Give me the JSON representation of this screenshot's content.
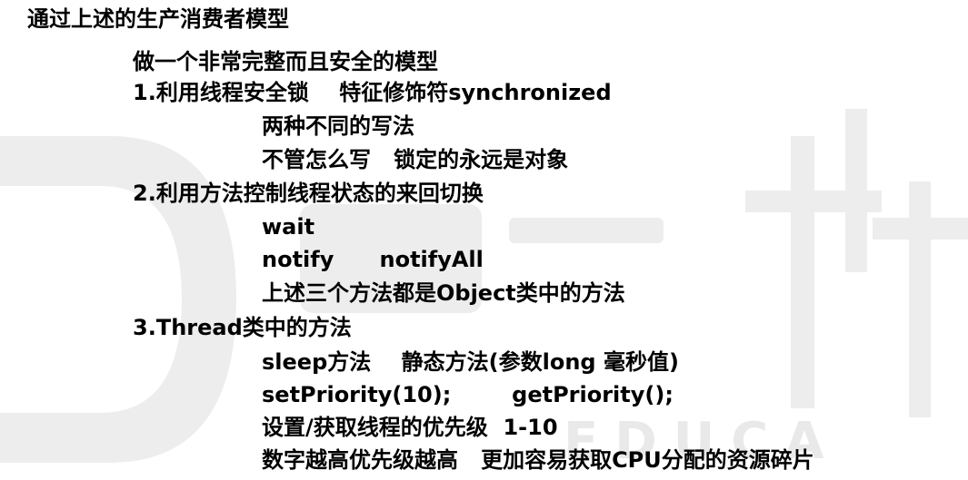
{
  "document": {
    "lines": [
      {
        "level": 0,
        "text": "通过上述的生产消费者模型"
      },
      {
        "level": 1,
        "text": "做一个非常完整而且安全的模型"
      },
      {
        "level": 1,
        "text": "1.利用线程安全锁    特征修饰符synchronized"
      },
      {
        "level": 2,
        "text": "两种不同的写法"
      },
      {
        "level": 2,
        "text": "不管怎么写   锁定的永远是对象"
      },
      {
        "level": 1,
        "text": "2.利用方法控制线程状态的来回切换"
      },
      {
        "level": 2,
        "text": "wait"
      },
      {
        "level": 2,
        "text": "notify      notifyAll"
      },
      {
        "level": 2,
        "text": "上述三个方法都是Object类中的方法"
      },
      {
        "level": 1,
        "text": "3.Thread类中的方法"
      },
      {
        "level": 2,
        "text": "sleep方法    静态方法(参数long 毫秒值)"
      },
      {
        "level": 2,
        "text": "setPriority(10);        getPriority();"
      },
      {
        "level": 2,
        "text": "设置/获取线程的优先级  1-10"
      },
      {
        "level": 2,
        "text": "数字越高优先级越高   更加容易获取CPU分配的资源碎片"
      }
    ]
  },
  "colors": {
    "text": "#000000",
    "background": "#ffffff",
    "watermark": "#ececec"
  }
}
